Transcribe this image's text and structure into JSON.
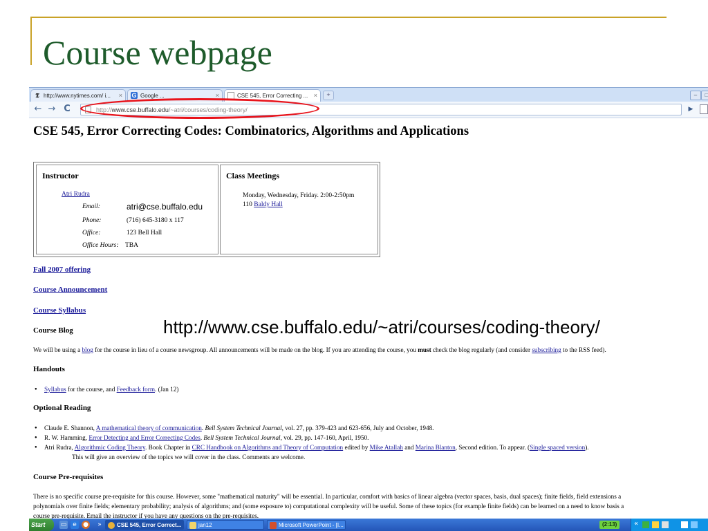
{
  "slide": {
    "title": "Course webpage"
  },
  "browser": {
    "tabs": [
      {
        "label": "http://www.nytimes.com/ i...",
        "icon": "nytimes-icon",
        "active": false
      },
      {
        "label": "Google ...",
        "icon": "google-icon",
        "active": false
      },
      {
        "label": "CSE 545, Error Correcting ...",
        "icon": "page-icon",
        "active": true
      }
    ],
    "new_tab_label": "+",
    "address": {
      "prefix": "http://",
      "domain": "www.cse.buffalo.edu",
      "path": "/~atri/courses/coding-theory/"
    }
  },
  "page": {
    "heading": "CSE 545, Error Correcting Codes: Combinatorics, Algorithms and Applications",
    "instructor": {
      "header": "Instructor",
      "name": "Atri Rudra",
      "email_label": "Email:",
      "email": "atri@cse.buffalo.edu",
      "phone_label": "Phone:",
      "phone": "(716) 645-3180 x 117",
      "office_label": "Office:",
      "office": "123 Bell Hall",
      "hours_label": "Office Hours:",
      "hours": "TBA"
    },
    "meetings": {
      "header": "Class Meetings",
      "schedule": "Monday, Wednesday, Friday. 2:00-2:50pm",
      "room_number": "110",
      "room_link": "Baldy Hall"
    },
    "links": {
      "fall_2007": "Fall 2007 offering",
      "announcement": "Course Announcement",
      "syllabus": "Course Syllabus"
    },
    "blog": {
      "header": "Course Blog",
      "p1": "We will be using a ",
      "blog_link": "blog",
      "p2": " for the course in lieu of a course newsgroup. All announcements will be made on the blog. If you are attending the course, you ",
      "must": "must",
      "p3": " check the blog regularly (and consider ",
      "subscribing_link": "subscribing",
      "p4": " to the RSS feed)."
    },
    "handouts": {
      "header": "Handouts",
      "syllabus_link": "Syllabus",
      "mid": " for the course, and ",
      "feedback_link": "Feedback form",
      "tail": ". (Jan 12)"
    },
    "optional_reading": {
      "header": "Optional Reading",
      "item1": {
        "author": "Claude E. Shannon, ",
        "link": "A mathematical theory of communication",
        "journal": "Bell System Technical Journal",
        "rest": ", vol. 27, pp. 379-423 and 623-656, July and October, 1948."
      },
      "item2": {
        "author": "R. W. Hamming, ",
        "link": "Error Detecting and Error Correcting Codes",
        "journal": "Bell System Technical Journal",
        "rest": ", vol. 29, pp. 147-160, April, 1950."
      },
      "item3": {
        "author": "Atri Rudra, ",
        "link": "Algorithmic Coding Theory",
        "mid": ". Book Chapter in ",
        "handbook_link": "CRC Handbook on Algorithms and Theory of Computation",
        "edited": " edited by ",
        "editor1": "Mike Atallah",
        "and": " and ",
        "editor2": "Marina Blanton",
        "tail": ", Second edition. To appear. (",
        "single_link": "Single spaced version",
        "end": ")."
      },
      "item3_note": "This will give an overview of the topics we will cover in the class. Comments are welcome."
    },
    "prereq": {
      "header": "Course Pre-requisites",
      "line1": "There is no specific course pre-requisite for this course. However, some \"mathematical maturity\" will be essential. In particular, comfort with basics of linear algebra (vector spaces, basis, dual spaces); finite fields, field extensions a",
      "line2": "polynomials over finite fields; elementary probability; analysis of algorithms; and (some exposure to) computational complexity will be useful. Some of these topics (for example finite fields) can be learned on a need to know basis a",
      "line3": "course pre-requisite. Email the instructor if you have any questions on the pre-requisites."
    }
  },
  "overlay_url": "http://www.cse.buffalo.edu/~atri/courses/coding-theory/",
  "taskbar": {
    "start_label": "Start",
    "chevron": "»",
    "items": [
      {
        "label": "CSE 545, Error Correct...",
        "active": true
      },
      {
        "label": "jan12",
        "active": false
      },
      {
        "label": "Microsoft PowerPoint - [I...",
        "active": false
      }
    ],
    "clock": "(2:13)",
    "tray_chevron": "«"
  },
  "colors": {
    "title_green": "#1e5b2b",
    "frame_gold": "#c9a227",
    "annotation_red": "#e8141c",
    "link_blue": "#1a1a99"
  }
}
